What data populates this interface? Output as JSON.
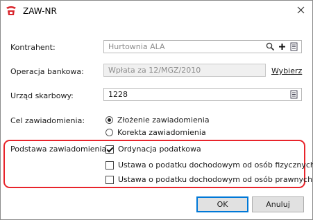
{
  "window": {
    "title": "ZAW-NR",
    "close_icon": "close-icon",
    "app_icon": "app-logo-icon"
  },
  "form": {
    "kontrahent": {
      "label": "Kontrahent:",
      "value": "Hurtownia ALA",
      "icons": [
        "search-icon",
        "plus-icon",
        "list-icon"
      ]
    },
    "operacja": {
      "label": "Operacja bankowa:",
      "value": "Wpłata za 12/MGZ/2010",
      "link": "Wybierz"
    },
    "urzad": {
      "label": "Urząd skarbowy:",
      "value": "1228",
      "icons": [
        "list-icon"
      ]
    },
    "cel": {
      "label": "Cel zawiadomienia:",
      "options": [
        {
          "label": "Złożenie zawiadomienia",
          "selected": true
        },
        {
          "label": "Korekta zawiadomienia",
          "selected": false
        }
      ]
    },
    "podstawa": {
      "label": "Podstawa zawiadomienia:",
      "options": [
        {
          "label": "Ordynacja podatkowa",
          "checked": true
        },
        {
          "label": "Ustawa o podatku dochodowym od osób fizycznych",
          "checked": false
        },
        {
          "label": "Ustawa o podatku dochodowym od osób prawnych",
          "checked": false
        }
      ]
    }
  },
  "buttons": {
    "ok": "OK",
    "cancel": "Anuluj"
  },
  "colors": {
    "highlight": "#e8242b",
    "default_button_border": "#0078d7"
  }
}
